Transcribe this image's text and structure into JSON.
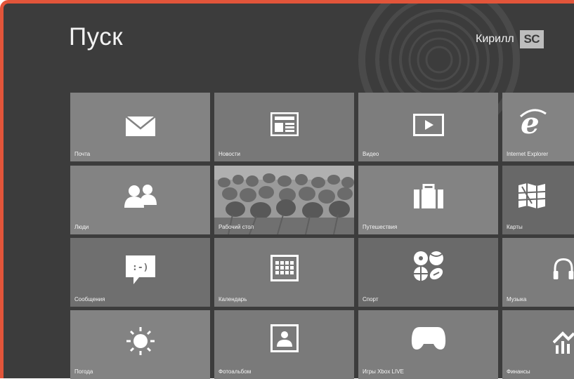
{
  "screen": {
    "title": "Пуск",
    "user_name": "Кирилл",
    "avatar_text": "SC"
  },
  "accent": "#e2553a",
  "tiles": [
    {
      "label": "Почта",
      "icon": "mail-icon"
    },
    {
      "label": "Новости",
      "icon": "news-icon"
    },
    {
      "label": "Видео",
      "icon": "video-icon"
    },
    {
      "label": "Internet Explorer",
      "icon": "internet-explorer-icon"
    },
    {
      "label": "Люди",
      "icon": "people-icon"
    },
    {
      "label": "Рабочий стол",
      "icon": "tulips-photo"
    },
    {
      "label": "Путешествия",
      "icon": "suitcase-icon"
    },
    {
      "label": "Карты",
      "icon": "map-icon"
    },
    {
      "label": "Сообщения",
      "icon": "message-icon"
    },
    {
      "label": "Календарь",
      "icon": "calendar-icon"
    },
    {
      "label": "Спорт",
      "icon": "sports-balls-icon"
    },
    {
      "label": "Музыка",
      "icon": "headphones-icon"
    },
    {
      "label": "Погода",
      "icon": "sun-icon"
    },
    {
      "label": "Фотоальбом",
      "icon": "photo-icon"
    },
    {
      "label": "Игры Xbox LIVE",
      "icon": "gamepad-icon"
    },
    {
      "label": "Финансы",
      "icon": "finance-icon"
    }
  ]
}
